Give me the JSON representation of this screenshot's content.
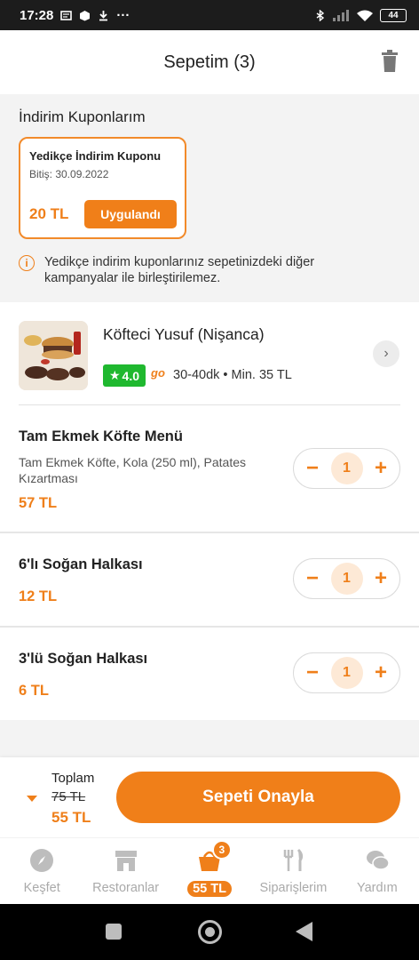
{
  "status_bar": {
    "time": "17:28",
    "dots": "···",
    "battery": "44"
  },
  "header": {
    "title": "Sepetim (3)"
  },
  "coupons": {
    "section_title": "İndirim Kuponlarım",
    "card": {
      "title": "Yedikçe İndirim Kuponu",
      "expiry": "Bitiş: 30.09.2022",
      "amount": "20 TL",
      "button_label": "Uygulandı"
    },
    "info_icon": "info-icon",
    "info_text": "Yedikçe indirim kuponlarınız sepetinizdeki diğer kampanyalar ile birleştirilemez."
  },
  "restaurant": {
    "name": "Köfteci Yusuf (Nişanca)",
    "rating": "4.0",
    "go_label": "go",
    "meta": "30-40dk • Min. 35 TL"
  },
  "items": [
    {
      "name": "Tam Ekmek Köfte Menü",
      "description": "Tam Ekmek Köfte, Kola (250 ml), Patates Kızartması",
      "price": "57 TL",
      "quantity": "1"
    },
    {
      "name": "6'lı Soğan Halkası",
      "description": "",
      "price": "12 TL",
      "quantity": "1"
    },
    {
      "name": "3'lü Soğan Halkası",
      "description": "",
      "price": "6 TL",
      "quantity": "1"
    }
  ],
  "stepper": {
    "minus": "−",
    "plus": "+"
  },
  "summary": {
    "label": "Toplam",
    "old_total": "75 TL",
    "new_total": "55 TL",
    "confirm_label": "Sepeti Onayla"
  },
  "tabs": [
    {
      "label": "Keşfet",
      "icon": "compass-icon"
    },
    {
      "label": "Restoranlar",
      "icon": "store-icon"
    },
    {
      "label": "55 TL",
      "icon": "basket-icon",
      "badge": "3",
      "active": true
    },
    {
      "label": "Siparişlerim",
      "icon": "cutlery-icon"
    },
    {
      "label": "Yardım",
      "icon": "chat-icon"
    }
  ],
  "colors": {
    "accent": "#ef7f1a",
    "rating_green": "#1fb82f"
  }
}
